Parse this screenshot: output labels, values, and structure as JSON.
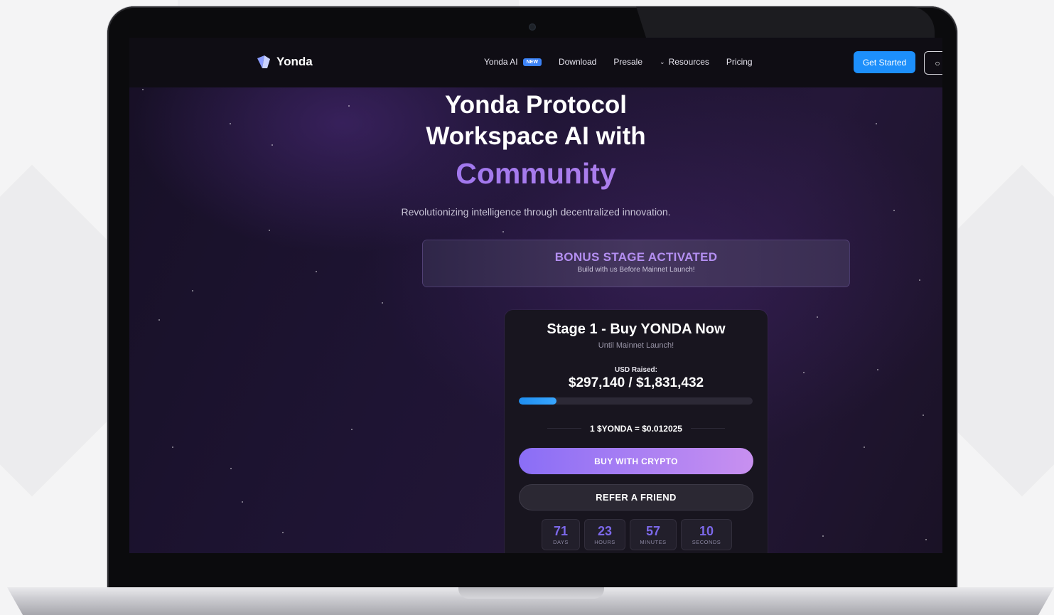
{
  "nav": {
    "logo": "Yonda",
    "links": [
      "Yonda AI",
      "Download",
      "Presale",
      "Resources",
      "Pricing"
    ],
    "badge": "NEW",
    "cta": "Get Started"
  },
  "hero": {
    "line1": "Yonda Protocol",
    "line2": "Workspace AI with",
    "accent": "Community",
    "subtitle": "Revolutionizing intelligence through decentralized innovation."
  },
  "bonus": {
    "title": "BONUS STAGE ACTIVATED",
    "subtitle": "Build with us Before Mainnet Launch!"
  },
  "presale": {
    "title": "Stage 1 - Buy YONDA Now",
    "subtitle": "Until Mainnet Launch!",
    "raised_label": "USD Raised:",
    "raised_value": "$297,140 / $1,831,432",
    "progress_fraction": 0.162,
    "rate": "1 $YONDA = $0.012025",
    "buy_label": "BUY WITH CRYPTO",
    "refer_label": "REFER A FRIEND",
    "countdown": [
      {
        "value": "71",
        "label": "DAYS"
      },
      {
        "value": "23",
        "label": "HOURS"
      },
      {
        "value": "57",
        "label": "MINUTES"
      },
      {
        "value": "10",
        "label": "SECONDS"
      }
    ]
  },
  "colors": {
    "accent": "#a57bf0",
    "primary_button": "#1d8ffb",
    "progress": "#1f8ff0"
  }
}
